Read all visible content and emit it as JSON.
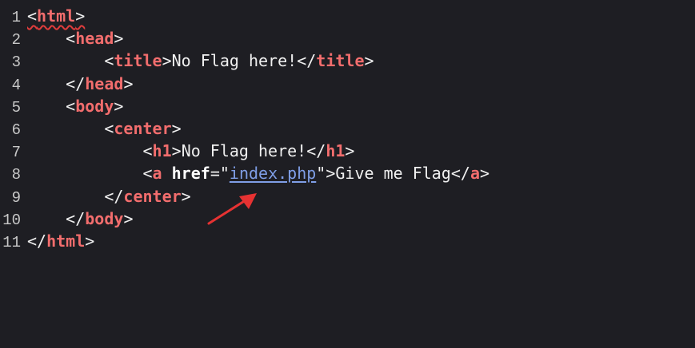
{
  "editor": {
    "lines": [
      {
        "num": "1",
        "indent": "",
        "parts": [
          [
            "punct",
            "<"
          ],
          [
            "tag",
            "html"
          ],
          [
            "punct",
            ">"
          ]
        ]
      },
      {
        "num": "2",
        "indent": "    ",
        "parts": [
          [
            "punct",
            "<"
          ],
          [
            "tag",
            "head"
          ],
          [
            "punct",
            ">"
          ]
        ]
      },
      {
        "num": "3",
        "indent": "        ",
        "parts": [
          [
            "punct",
            "<"
          ],
          [
            "tag",
            "title"
          ],
          [
            "punct",
            ">"
          ],
          [
            "text",
            "No Flag here!"
          ],
          [
            "punct",
            "</"
          ],
          [
            "tag",
            "title"
          ],
          [
            "punct",
            ">"
          ]
        ]
      },
      {
        "num": "4",
        "indent": "    ",
        "parts": [
          [
            "punct",
            "</"
          ],
          [
            "tag",
            "head"
          ],
          [
            "punct",
            ">"
          ]
        ]
      },
      {
        "num": "5",
        "indent": "    ",
        "parts": [
          [
            "punct",
            "<"
          ],
          [
            "tag",
            "body"
          ],
          [
            "punct",
            ">"
          ]
        ]
      },
      {
        "num": "6",
        "indent": "        ",
        "parts": [
          [
            "punct",
            "<"
          ],
          [
            "tag",
            "center"
          ],
          [
            "punct",
            ">"
          ]
        ]
      },
      {
        "num": "7",
        "indent": "            ",
        "parts": [
          [
            "punct",
            "<"
          ],
          [
            "tag",
            "h1"
          ],
          [
            "punct",
            ">"
          ],
          [
            "text",
            "No Flag here!"
          ],
          [
            "punct",
            "</"
          ],
          [
            "tag",
            "h1"
          ],
          [
            "punct",
            ">"
          ]
        ]
      },
      {
        "num": "8",
        "indent": "            ",
        "parts": [
          [
            "punct",
            "<"
          ],
          [
            "tag",
            "a"
          ],
          [
            "punct",
            " "
          ],
          [
            "attr",
            "href"
          ],
          [
            "punct",
            "=\""
          ],
          [
            "link",
            "index.php"
          ],
          [
            "punct",
            "\">"
          ],
          [
            "text",
            "Give me Flag"
          ],
          [
            "punct",
            "</"
          ],
          [
            "tag",
            "a"
          ],
          [
            "punct",
            ">"
          ]
        ]
      },
      {
        "num": "9",
        "indent": "        ",
        "parts": [
          [
            "punct",
            "</"
          ],
          [
            "tag",
            "center"
          ],
          [
            "punct",
            ">"
          ]
        ]
      },
      {
        "num": "10",
        "indent": "    ",
        "parts": [
          [
            "punct",
            "</"
          ],
          [
            "tag",
            "body"
          ],
          [
            "punct",
            ">"
          ]
        ]
      },
      {
        "num": "11",
        "indent": "",
        "parts": [
          [
            "punct",
            "</"
          ],
          [
            "tag",
            "html"
          ],
          [
            "punct",
            ">"
          ]
        ]
      }
    ]
  },
  "annotation": {
    "icon": "red-arrow-icon",
    "color": "#e63232"
  }
}
